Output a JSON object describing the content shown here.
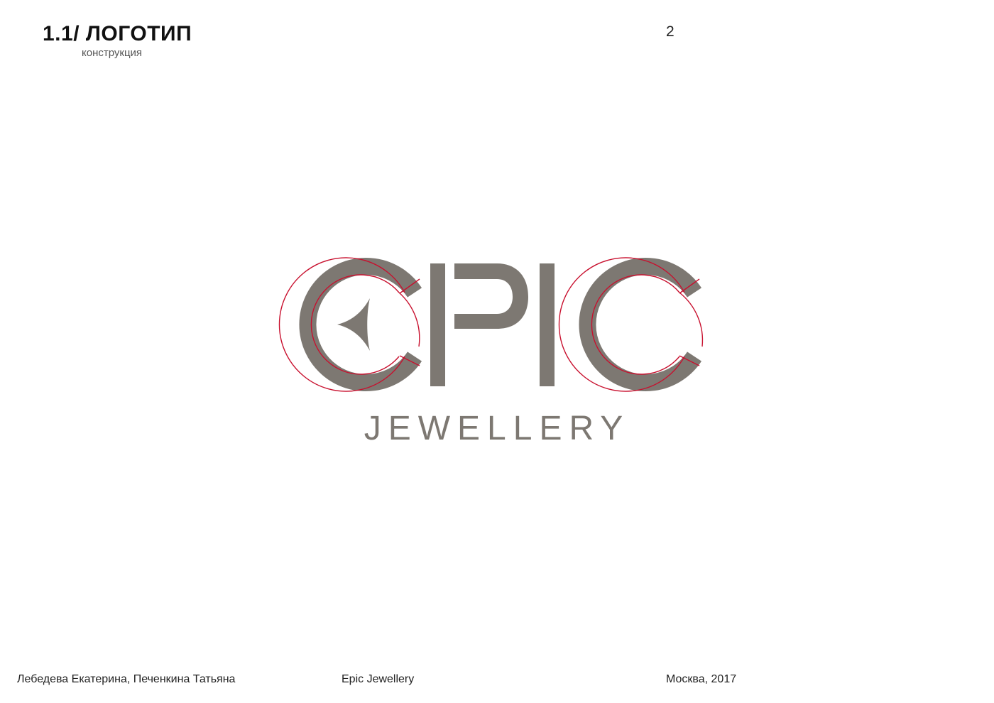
{
  "header": {
    "section_title": "1.1/ ЛОГОТИП",
    "section_subtitle": "конструкция",
    "page_number": "2"
  },
  "logo": {
    "wordmark": "EPIC",
    "tagline": "JEWELLERY",
    "colors": {
      "mark": "#7d7872",
      "construction_lines": "#c8102e"
    }
  },
  "footer": {
    "authors": "Лебедева Екатерина, Печенкина Татьяна",
    "project": "Epic Jewellery",
    "place_year": "Москва, 2017"
  }
}
